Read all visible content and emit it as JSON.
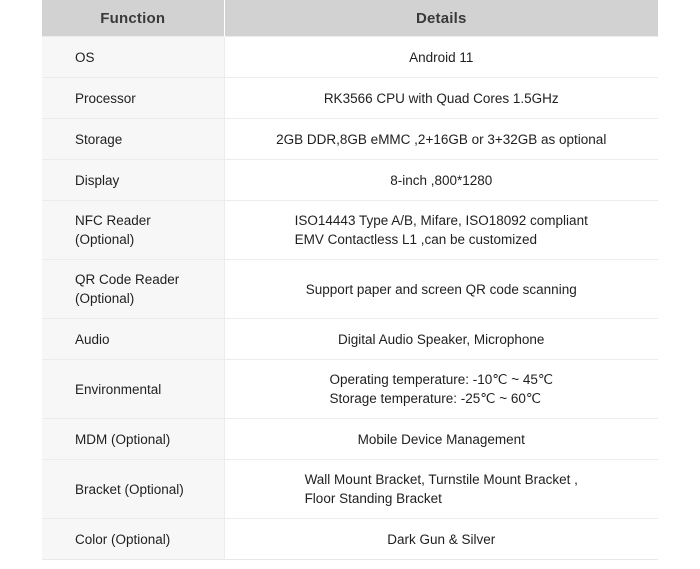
{
  "table": {
    "headers": {
      "function": "Function",
      "details": "Details"
    },
    "rows": [
      {
        "function": "OS",
        "function_line2": "",
        "details": "Android 11",
        "multiline": false
      },
      {
        "function": "Processor",
        "function_line2": "",
        "details": "RK3566 CPU with Quad Cores 1.5GHz",
        "multiline": false
      },
      {
        "function": "Storage",
        "function_line2": "",
        "details": "2GB DDR,8GB eMMC ,2+16GB or 3+32GB as optional",
        "multiline": false
      },
      {
        "function": "Display",
        "function_line2": "",
        "details": "8-inch ,800*1280",
        "multiline": false
      },
      {
        "function": "NFC Reader",
        "function_line2": "(Optional)",
        "details": "ISO14443 Type A/B, Mifare, ISO18092 compliant\nEMV Contactless L1 ,can be customized",
        "multiline": true
      },
      {
        "function": "QR Code Reader",
        "function_line2": "(Optional)",
        "details": "Support paper and screen QR code scanning",
        "multiline": true
      },
      {
        "function": "Audio",
        "function_line2": "",
        "details": "Digital Audio Speaker, Microphone",
        "multiline": false
      },
      {
        "function": "Environmental",
        "function_line2": "",
        "details": "Operating temperature: -10℃ ~ 45℃\nStorage temperature: -25℃ ~ 60℃",
        "multiline": true
      },
      {
        "function": "MDM (Optional)",
        "function_line2": "",
        "details": "Mobile Device Management",
        "multiline": false
      },
      {
        "function": "Bracket (Optional)",
        "function_line2": "",
        "details": "Wall Mount Bracket, Turnstile Mount Bracket ,\nFloor Standing Bracket",
        "multiline": true
      },
      {
        "function": "Color (Optional)",
        "function_line2": "",
        "details": "Dark Gun & Silver",
        "multiline": false
      }
    ]
  },
  "colors": {
    "header_background": "#d2d2d2",
    "function_column_background": "#f7f7f7",
    "details_column_background": "#ffffff",
    "row_border": "#ececec",
    "text": "#1f1f1f"
  }
}
